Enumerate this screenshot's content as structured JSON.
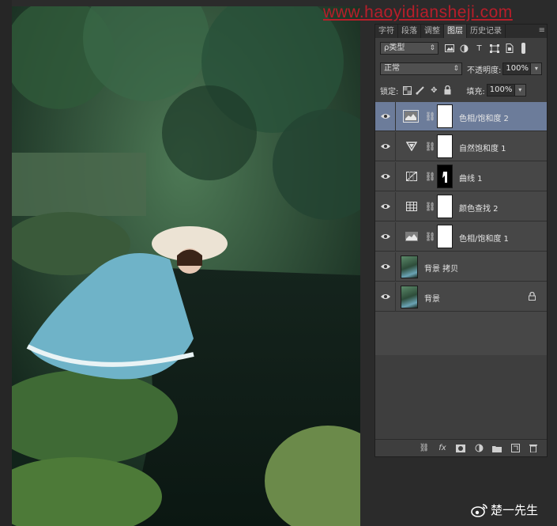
{
  "watermark": {
    "text": "www.haoyidiansheji.com"
  },
  "panel": {
    "tabs": [
      {
        "label": "字符"
      },
      {
        "label": "段落"
      },
      {
        "label": "调整"
      },
      {
        "label": "图层"
      },
      {
        "label": "历史记录"
      }
    ],
    "active_tab": "图层",
    "filter": {
      "label": "ρ类型",
      "icons": [
        "image-filter-icon",
        "adjustment-filter-icon",
        "type-filter-icon",
        "shape-filter-icon",
        "smart-object-filter-icon"
      ]
    },
    "blend_mode": "正常",
    "opacity_label": "不透明度:",
    "opacity_value": "100%",
    "lock_label": "锁定:",
    "fill_label": "填充:",
    "fill_value": "100%",
    "layers": [
      {
        "name": "色相/饱和度 2",
        "icon": "hue-saturation-icon",
        "mask": "white",
        "selected": true
      },
      {
        "name": "自然饱和度 1",
        "icon": "vibrance-icon",
        "mask": "white",
        "selected": false
      },
      {
        "name": "曲线 1",
        "icon": "curves-icon",
        "mask": "black",
        "selected": false
      },
      {
        "name": "颜色查找 2",
        "icon": "color-lookup-icon",
        "mask": "white",
        "selected": false
      },
      {
        "name": "色相/饱和度 1",
        "icon": "hue-saturation-icon",
        "mask": "white",
        "selected": false
      },
      {
        "name": "背景 拷贝",
        "icon": "image-thumbnail",
        "mask": "none",
        "selected": false
      },
      {
        "name": "背景",
        "icon": "image-thumbnail",
        "mask": "none",
        "selected": false,
        "locked": true
      }
    ],
    "bottom_icons": [
      "link-icon",
      "fx-icon",
      "add-mask-icon",
      "adjustment-layer-icon",
      "folder-icon",
      "new-layer-icon",
      "trash-icon"
    ]
  },
  "credit": {
    "text": "楚一先生"
  }
}
